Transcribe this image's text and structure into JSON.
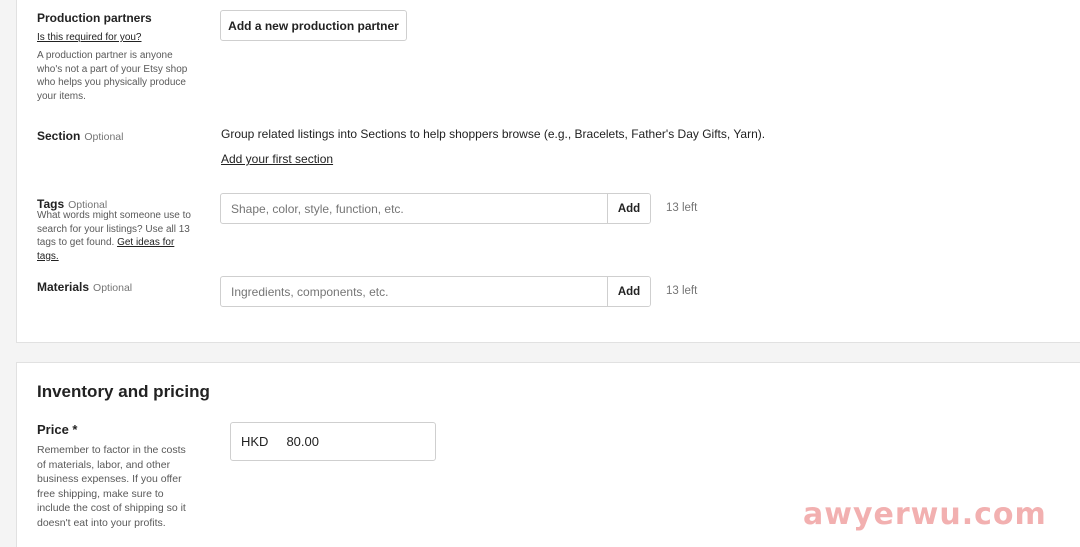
{
  "production_partners": {
    "title": "Production partners",
    "required_link": "Is this required for you?",
    "help": "A production partner is anyone who's not a part of your Etsy shop who helps you physically produce your items.",
    "button": "Add a new production partner"
  },
  "section": {
    "title": "Section",
    "optional": "Optional",
    "description": "Group related listings into Sections to help shoppers browse (e.g., Bracelets, Father's Day Gifts, Yarn).",
    "link": "Add your first section"
  },
  "tags": {
    "title": "Tags",
    "optional": "Optional",
    "help": "What words might someone use to search for your listings? Use all 13 tags to get found.",
    "help_link": "Get ideas for tags.",
    "placeholder": "Shape, color, style, function, etc.",
    "add": "Add",
    "count": "13 left"
  },
  "materials": {
    "title": "Materials",
    "optional": "Optional",
    "placeholder": "Ingredients, components, etc.",
    "add": "Add",
    "count": "13 left"
  },
  "inventory": {
    "heading": "Inventory and pricing",
    "price_label": "Price *",
    "price_help": "Remember to factor in the costs of materials, labor, and other business expenses. If you offer free shipping, make sure to include the cost of shipping so it doesn't eat into your profits.",
    "currency": "HKD",
    "price_value": "80.00"
  },
  "watermark": "awyerwu.com"
}
